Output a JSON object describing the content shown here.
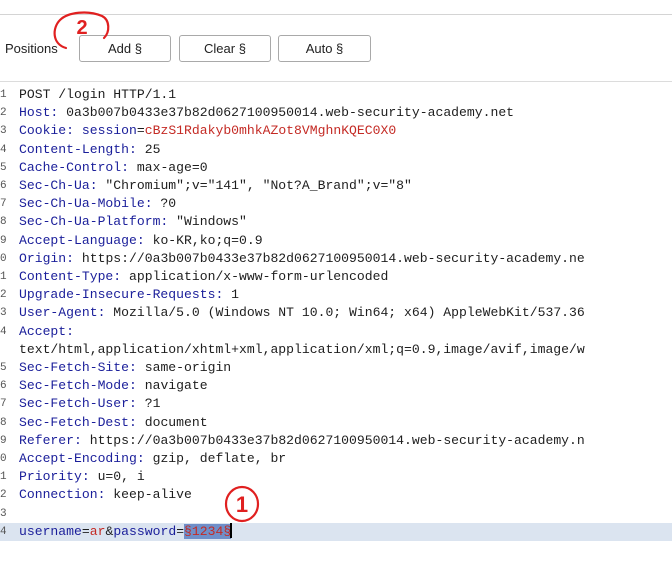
{
  "toolbar": {
    "positions_label": "Positions",
    "add_label": "Add §",
    "clear_label": "Clear §",
    "auto_label": "Auto §"
  },
  "request": {
    "line1": "POST /login HTTP/1.1",
    "host_key": "Host:",
    "host_val": " 0a3b007b0433e37b82d0627100950014.web-security-academy.net",
    "cookie_key": "Cookie:",
    "cookie_name": " session",
    "cookie_eq": "=",
    "cookie_val": "cBzS1Rdakyb0mhkAZot8VMghnKQEC0X0",
    "cl_key": "Content-Length:",
    "cl_val": " 25",
    "cc_key": "Cache-Control:",
    "cc_val": " max-age=0",
    "ua_key": "Sec-Ch-Ua:",
    "ua_val": " \"Chromium\";v=\"141\", \"Not?A_Brand\";v=\"8\"",
    "mob_key": "Sec-Ch-Ua-Mobile:",
    "mob_val": " ?0",
    "plat_key": "Sec-Ch-Ua-Platform:",
    "plat_val": " \"Windows\"",
    "al_key": "Accept-Language:",
    "al_val": " ko-KR,ko;q=0.9",
    "origin_key": "Origin:",
    "origin_val": " https://0a3b007b0433e37b82d0627100950014.web-security-academy.ne",
    "ct_key": "Content-Type:",
    "ct_val": " application/x-www-form-urlencoded",
    "uir_key": "Upgrade-Insecure-Requests:",
    "uir_val": " 1",
    "uagent_key": "User-Agent:",
    "uagent_val": " Mozilla/5.0 (Windows NT 10.0; Win64; x64) AppleWebKit/537.36",
    "accept_key": "Accept:",
    "accept_val": "text/html,application/xhtml+xml,application/xml;q=0.9,image/avif,image/w",
    "sfs_key": "Sec-Fetch-Site:",
    "sfs_val": " same-origin",
    "sfm_key": "Sec-Fetch-Mode:",
    "sfm_val": " navigate",
    "sfu_key": "Sec-Fetch-User:",
    "sfu_val": " ?1",
    "sfd_key": "Sec-Fetch-Dest:",
    "sfd_val": " document",
    "ref_key": "Referer:",
    "ref_val": " https://0a3b007b0433e37b82d0627100950014.web-security-academy.n",
    "ae_key": "Accept-Encoding:",
    "ae_val": " gzip, deflate, br",
    "pri_key": "Priority:",
    "pri_val": " u=0, i",
    "conn_key": "Connection:",
    "conn_val": " keep-alive",
    "body_user_key": "username",
    "body_eq1": "=",
    "body_user_val": "ar",
    "body_amp": "&",
    "body_pass_key": "password",
    "body_eq2": "=",
    "body_pass_payload": "§1234§"
  },
  "line_numbers": [
    "1",
    "2",
    "3",
    "4",
    "5",
    "6",
    "7",
    "8",
    "9",
    "0",
    "1",
    "2",
    "3",
    "4",
    "",
    "5",
    "6",
    "7",
    "8",
    "9",
    "0",
    "1",
    "2",
    "3",
    "4"
  ],
  "annotations": [
    "2",
    "1"
  ]
}
